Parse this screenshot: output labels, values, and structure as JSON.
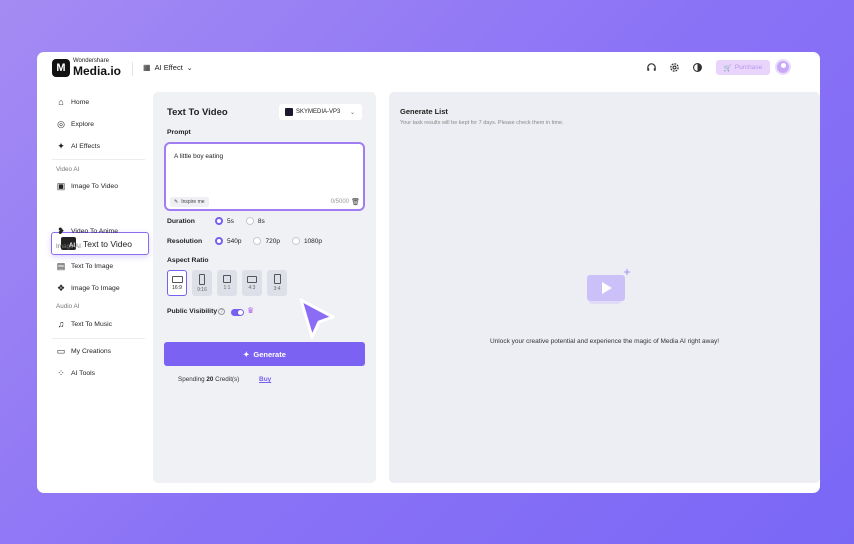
{
  "brand": {
    "small": "Wondershare",
    "big": "Media.io",
    "mark": "M"
  },
  "header": {
    "effect_label": "AI Effect",
    "purchase_label": "Purchase"
  },
  "sidebar": {
    "items": [
      {
        "label": "Home"
      },
      {
        "label": "Explore"
      },
      {
        "label": "AI Effects"
      },
      {
        "label": "Image To Video"
      },
      {
        "label": "Text to Video"
      },
      {
        "label": "Video To Anime"
      },
      {
        "label": "Text To Image"
      },
      {
        "label": "Image To Image"
      },
      {
        "label": "Text To Music"
      },
      {
        "label": "My Creations"
      },
      {
        "label": "AI Tools"
      }
    ],
    "categories": {
      "video": "Video AI",
      "image": "Image AI",
      "audio": "Audio AI"
    }
  },
  "panel": {
    "title": "Text To Video",
    "model": "SKYMEDIA-VP3",
    "prompt_label": "Prompt",
    "prompt_value": "A little boy eating",
    "inspire_label": "Inspire me",
    "char_count": "0/5000",
    "duration_label": "Duration",
    "durations": [
      "5s",
      "8s"
    ],
    "resolution_label": "Resolution",
    "resolutions": [
      "540p",
      "720p",
      "1080p"
    ],
    "aspect_label": "Aspect Ratio",
    "aspects": [
      "16:9",
      "9:16",
      "1:1",
      "4:3",
      "3:4"
    ],
    "visibility_label": "Public Visibility",
    "help_glyph": "?",
    "generate_label": "Generate",
    "spend_prefix": "Spending",
    "spend_amount": "20",
    "spend_suffix": "Credit(s)",
    "buy_label": "Buy"
  },
  "list": {
    "title": "Generate List",
    "subtitle": "Your task results will be kept for 7 days. Please check them in time.",
    "empty_message": "Unlock your creative potential and experience the magic of Media AI right away!"
  },
  "colors": {
    "accent": "#7560f0",
    "bg_gradient": [
      "#a48bf3",
      "#7a67f6"
    ],
    "crown": "#b35cf0"
  }
}
